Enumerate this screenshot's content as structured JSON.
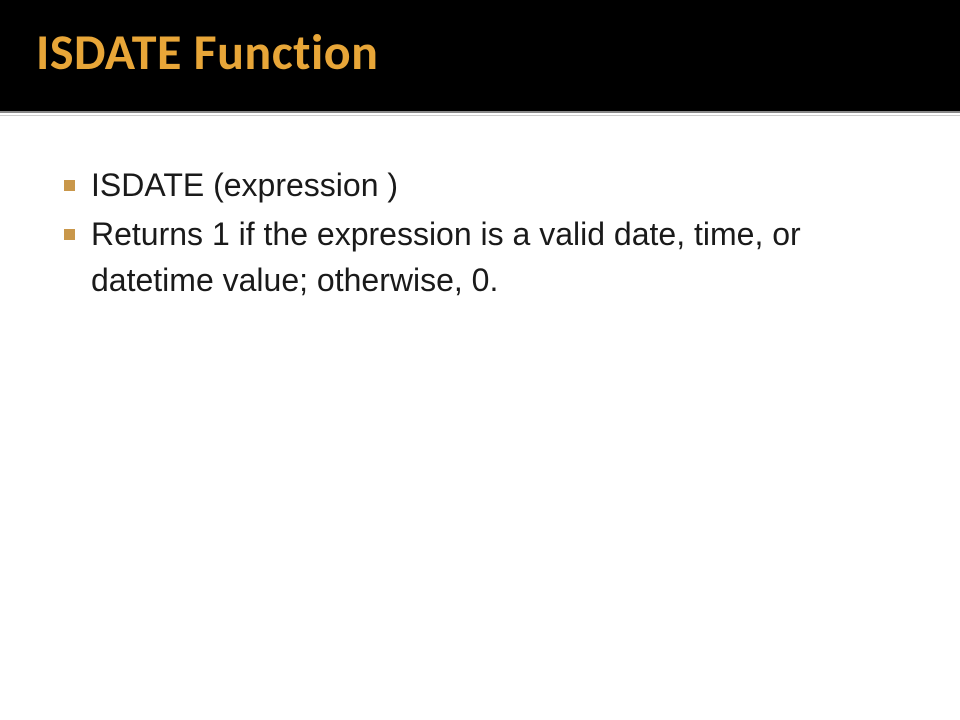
{
  "slide": {
    "title": "ISDATE Function",
    "bullets": [
      {
        "text": "ISDATE (expression )"
      },
      {
        "text": "Returns 1 if the expression is a valid date, time, or datetime value; otherwise, 0."
      }
    ]
  }
}
